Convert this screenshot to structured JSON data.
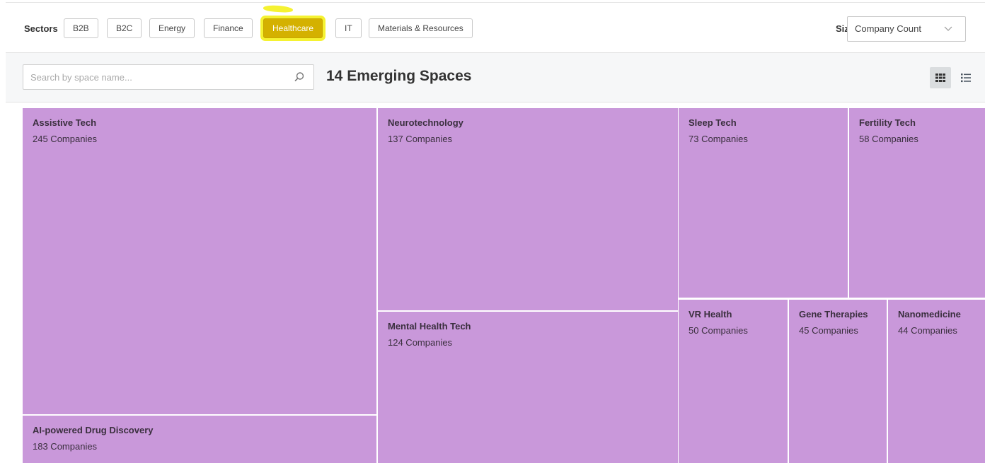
{
  "filters": {
    "sectors_label": "Sectors",
    "sectors": [
      {
        "label": "B2B",
        "active": false
      },
      {
        "label": "B2C",
        "active": false
      },
      {
        "label": "Energy",
        "active": false
      },
      {
        "label": "Finance",
        "active": false
      },
      {
        "label": "Healthcare",
        "active": true
      },
      {
        "label": "IT",
        "active": false
      },
      {
        "label": "Materials & Resources",
        "active": false
      }
    ],
    "size_label": "Size",
    "size_value": "Company Count"
  },
  "toolbar": {
    "search_placeholder": "Search by space name...",
    "title": "14 Emerging Spaces"
  },
  "colors": {
    "tile": "#c998da",
    "active_chip": "#d4b100",
    "highlight": "#f5f232"
  },
  "icons": {
    "search": "search-icon",
    "grid_view": "grid-view-icon",
    "list_view": "list-view-icon",
    "dropdown": "chevron-down-icon"
  },
  "spaces": [
    {
      "name": "Assistive Tech",
      "count": "245 Companies"
    },
    {
      "name": "AI-powered Drug Discovery",
      "count": "183 Companies"
    },
    {
      "name": "Neurotechnology",
      "count": "137 Companies"
    },
    {
      "name": "Mental Health Tech",
      "count": "124 Companies"
    },
    {
      "name": "Sleep Tech",
      "count": "73 Companies"
    },
    {
      "name": "Fertility Tech",
      "count": "58 Companies"
    },
    {
      "name": "VR Health",
      "count": "50 Companies"
    },
    {
      "name": "Gene Therapies",
      "count": "45 Companies"
    },
    {
      "name": "Nanomedicine",
      "count": "44 Companies"
    }
  ]
}
